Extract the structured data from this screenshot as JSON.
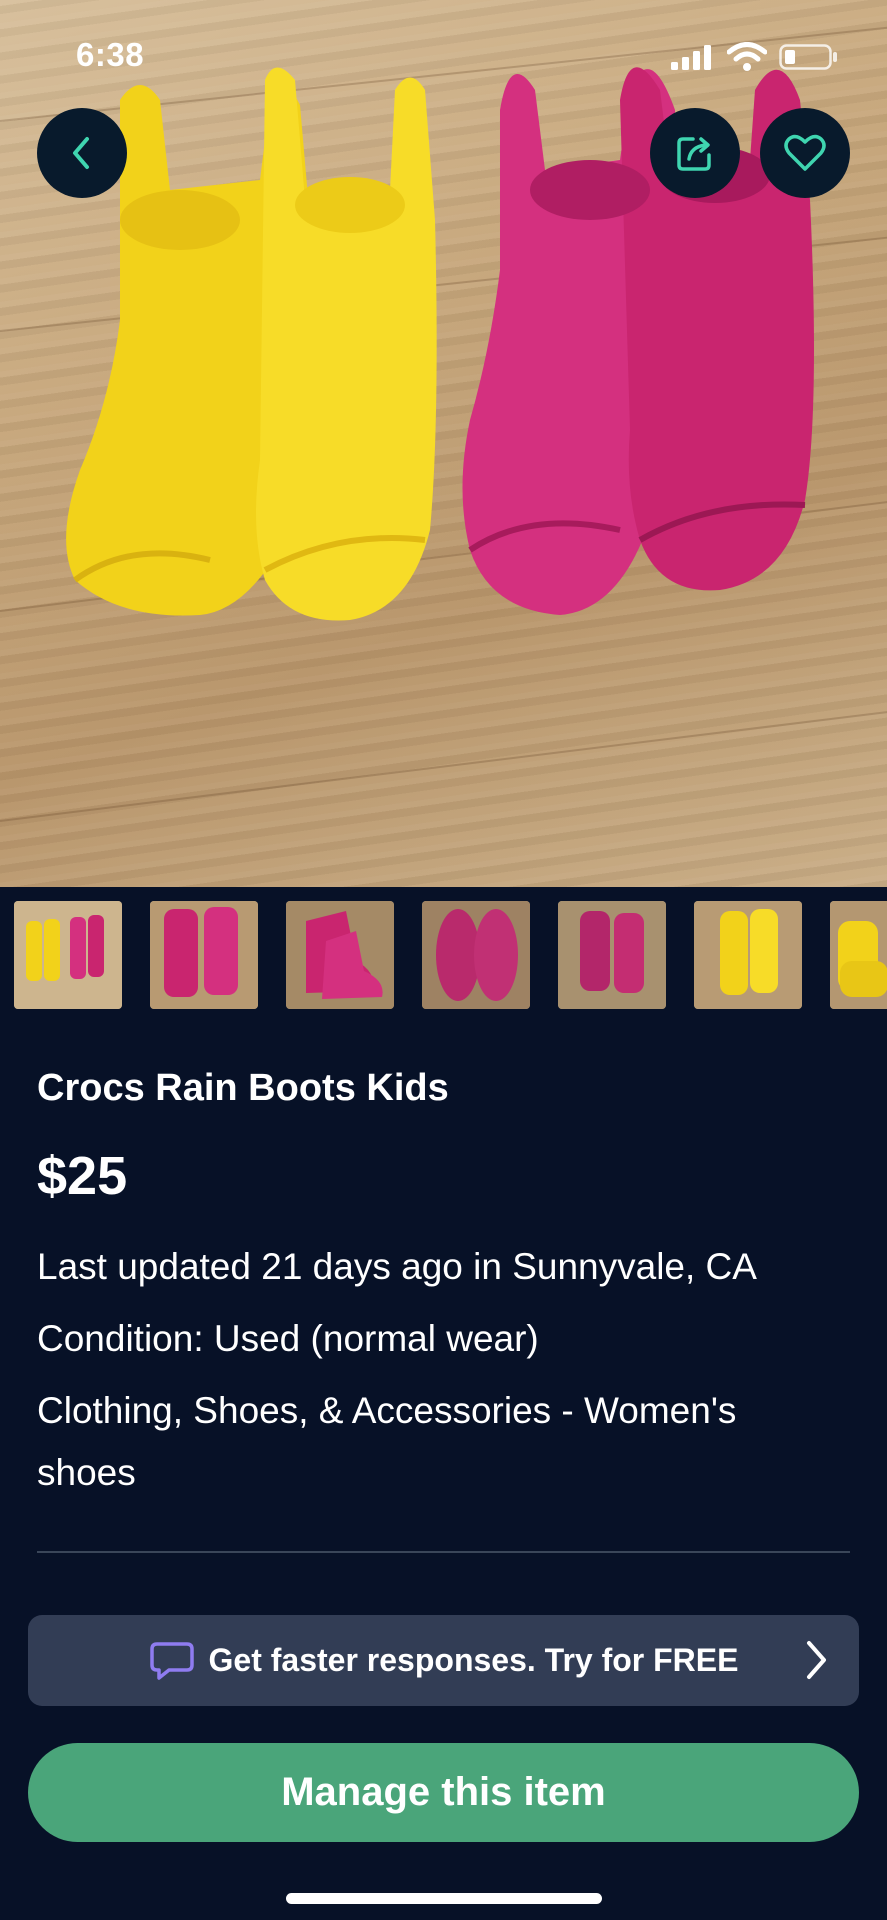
{
  "status_bar": {
    "time": "6:38"
  },
  "header": {
    "back_icon": "chevron-left-icon",
    "share_icon": "share-icon",
    "favorite_icon": "heart-icon"
  },
  "listing": {
    "title": "Crocs Rain Boots Kids",
    "price": "$25",
    "updated": "Last updated 21 days ago in Sunnyvale, CA",
    "condition": "Condition: Used (normal wear)",
    "category_line1": "Clothing, Shoes, & Accessories - Women's",
    "category_line2": "shoes"
  },
  "thumbnails": [
    {
      "label": "yellow and pink boots"
    },
    {
      "label": "pink boots front"
    },
    {
      "label": "pink boots side"
    },
    {
      "label": "pink boots soles"
    },
    {
      "label": "pink boots back"
    },
    {
      "label": "yellow boots"
    },
    {
      "label": "yellow boots side"
    }
  ],
  "promo": {
    "text": "Get faster responses.  Try for FREE",
    "icon": "chat-bubble-icon",
    "chevron": "chevron-right-icon"
  },
  "actions": {
    "manage_label": "Manage this item"
  },
  "colors": {
    "background": "#071127",
    "accent_green": "#4aa57a",
    "promo_bg": "#323d55",
    "icon_teal": "#3fd5b0",
    "promo_icon": "#8f7cf0"
  }
}
